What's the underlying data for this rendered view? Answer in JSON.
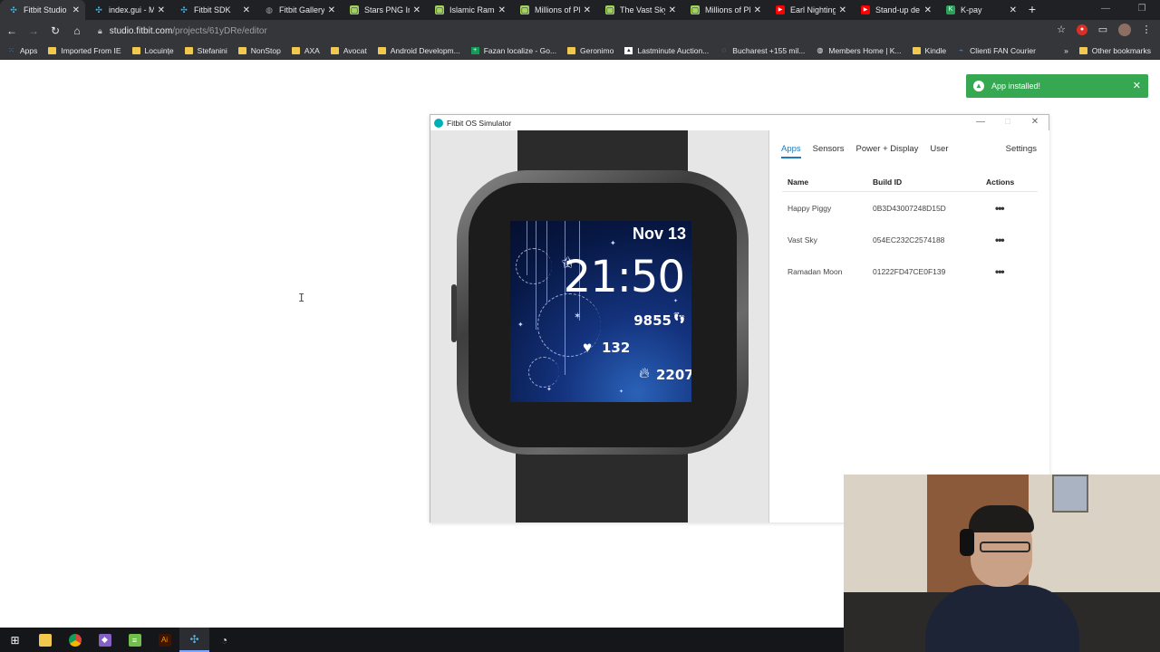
{
  "browser": {
    "tabs": [
      {
        "title": "Fitbit Studio",
        "icon": "fitbit-plus-icon",
        "color": "#4db6e6",
        "active": true
      },
      {
        "title": "index.gui - Mc",
        "icon": "fitbit-plus-icon",
        "color": "#4db6e6"
      },
      {
        "title": "Fitbit SDK",
        "icon": "fitbit-plus-icon",
        "color": "#4db6e6"
      },
      {
        "title": "Fitbit Gallery A",
        "icon": "globe-icon",
        "color": "#9aa0a6"
      },
      {
        "title": "Stars PNG Ima",
        "icon": "png-site-icon",
        "color": "#a6d35a"
      },
      {
        "title": "Islamic Ramad",
        "icon": "png-site-icon",
        "color": "#a6d35a"
      },
      {
        "title": "Millions of PN",
        "icon": "png-site-icon",
        "color": "#a6d35a"
      },
      {
        "title": "The Vast Sky, T",
        "icon": "png-site-icon",
        "color": "#a6d35a"
      },
      {
        "title": "Millions of PN",
        "icon": "png-site-icon",
        "color": "#a6d35a"
      },
      {
        "title": "Earl Nightinga",
        "icon": "youtube-icon",
        "color": "#ff0000"
      },
      {
        "title": "Stand-up de l",
        "icon": "youtube-icon",
        "color": "#ff0000"
      },
      {
        "title": "K-pay",
        "icon": "kpay-icon",
        "color": "#2e9e5b"
      }
    ],
    "url_host": "studio.fitbit.com",
    "url_path": "/projects/61yDRe/editor",
    "bookmarks": [
      {
        "label": "Apps",
        "icon": "apps-grid-icon"
      },
      {
        "label": "Imported From IE",
        "icon": "folder-icon"
      },
      {
        "label": "Locuințe",
        "icon": "folder-icon"
      },
      {
        "label": "Stefanini",
        "icon": "folder-icon"
      },
      {
        "label": "NonStop",
        "icon": "folder-icon"
      },
      {
        "label": "AXA",
        "icon": "folder-icon"
      },
      {
        "label": "Avocat",
        "icon": "folder-icon"
      },
      {
        "label": "Android Developm...",
        "icon": "folder-icon"
      },
      {
        "label": "Fazan localize - Go...",
        "icon": "sheets-icon"
      },
      {
        "label": "Geronimo",
        "icon": "folder-icon"
      },
      {
        "label": "Lastminute Auction...",
        "icon": "auction-icon"
      },
      {
        "label": "Bucharest +155 mil...",
        "icon": "loading-icon"
      },
      {
        "label": "Members Home | K...",
        "icon": "globe-icon"
      },
      {
        "label": "Kindle",
        "icon": "folder-icon"
      },
      {
        "label": "Clienti FAN Courier",
        "icon": "fan-courier-icon"
      }
    ],
    "bookmarks_overflow": "»",
    "other_bookmarks": "Other bookmarks"
  },
  "toast": {
    "message": "App installed!"
  },
  "simulator": {
    "window_title": "Fitbit OS Simulator",
    "tabs": [
      "Apps",
      "Sensors",
      "Power + Display",
      "User"
    ],
    "active_tab": "Apps",
    "settings_label": "Settings",
    "table": {
      "headers": {
        "name": "Name",
        "build_id": "Build ID",
        "actions": "Actions"
      },
      "rows": [
        {
          "name": "Happy Piggy",
          "build_id": "0B3D43007248D15D",
          "actions": "•••"
        },
        {
          "name": "Vast Sky",
          "build_id": "054EC232C2574188",
          "actions": "•••"
        },
        {
          "name": "Ramadan Moon",
          "build_id": "01222FD47CE0F139",
          "actions": "•••"
        }
      ]
    },
    "watchface": {
      "date": "Nov 13",
      "time": "21:50",
      "steps": "9855",
      "heart_rate": "132",
      "calories": "2207"
    }
  },
  "taskbar": {
    "items": [
      "windows-start-icon",
      "file-explorer-icon",
      "chrome-icon",
      "visual-studio-icon",
      "notepad-icon",
      "illustrator-icon",
      "fitbit-icon",
      "clock-app-icon"
    ]
  }
}
